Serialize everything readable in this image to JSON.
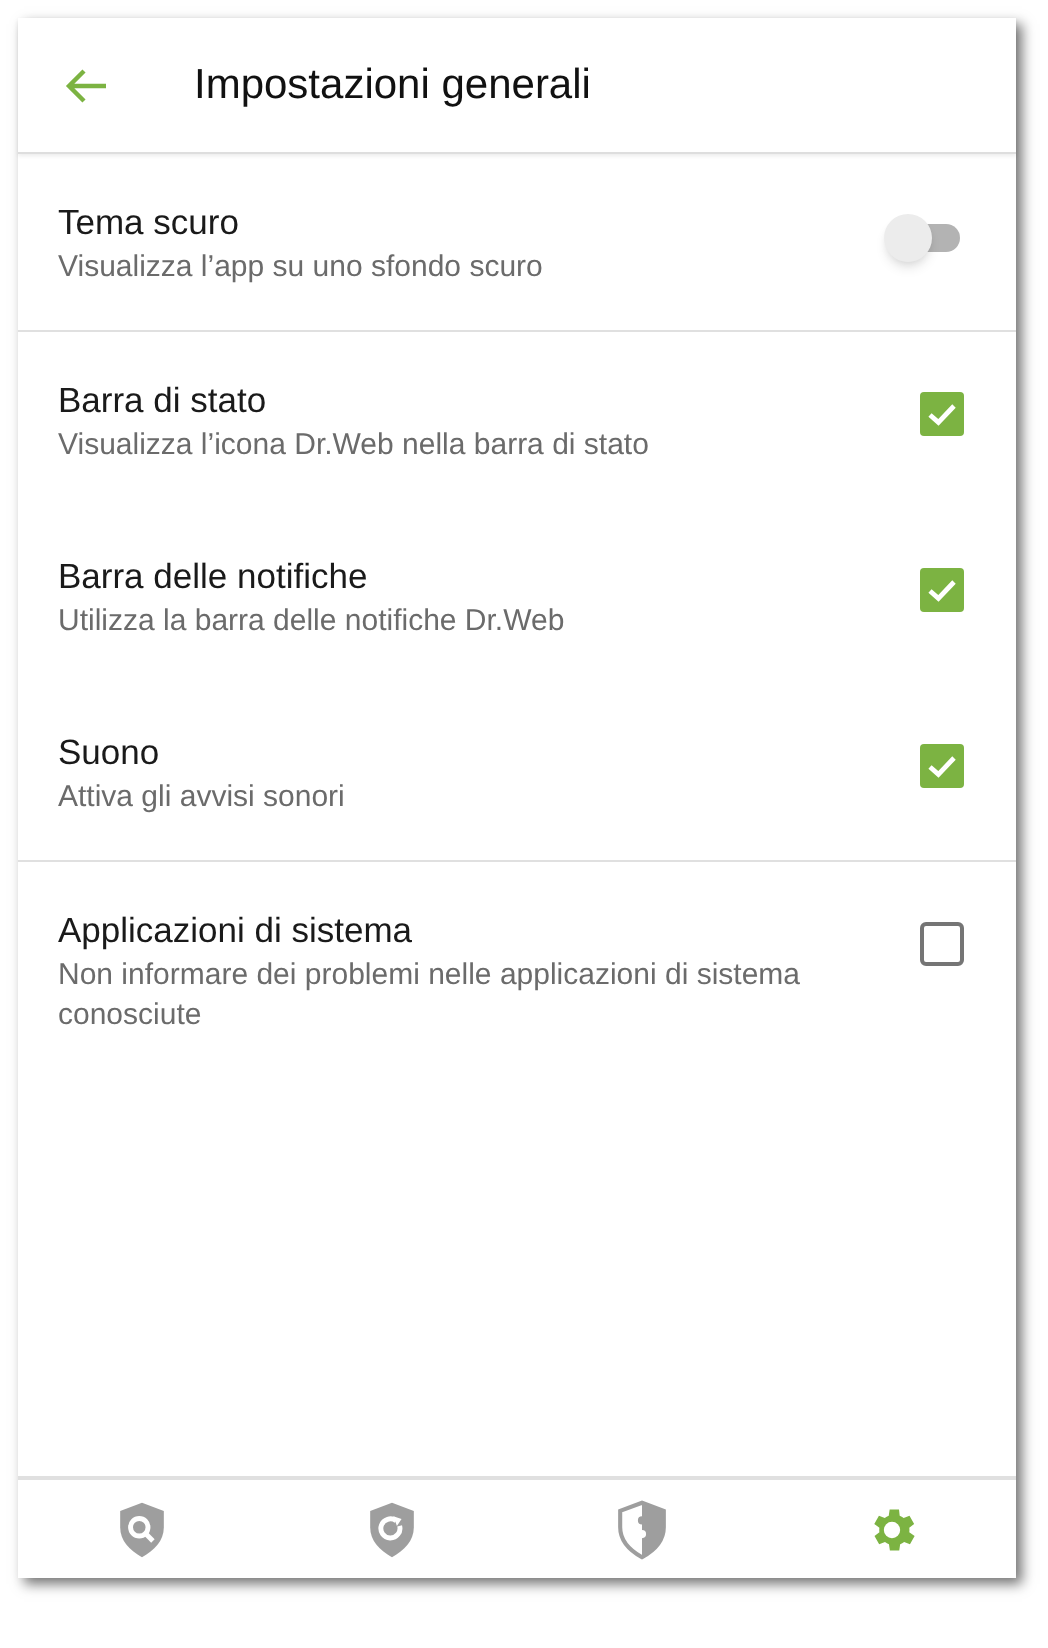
{
  "header": {
    "title": "Impostazioni generali"
  },
  "sections": [
    [
      {
        "kind": "switch",
        "title": "Tema scuro",
        "subtitle": "Visualizza l’app su uno sfondo scuro",
        "on": false
      }
    ],
    [
      {
        "kind": "checkbox",
        "title": "Barra di stato",
        "subtitle": "Visualizza l’icona Dr.Web nella barra di stato",
        "checked": true
      },
      {
        "kind": "checkbox",
        "title": "Barra delle notifiche",
        "subtitle": "Utilizza la barra delle notifiche Dr.Web",
        "checked": true
      },
      {
        "kind": "checkbox",
        "title": "Suono",
        "subtitle": "Attiva gli avvisi sonori",
        "checked": true
      }
    ],
    [
      {
        "kind": "checkbox",
        "title": "Applicazioni di sistema",
        "subtitle": "Non informare dei problemi nelle applicazioni di sistema conosciute",
        "checked": false
      }
    ]
  ],
  "bottom_nav": [
    {
      "kind": "scan",
      "selected": false
    },
    {
      "kind": "update",
      "selected": false
    },
    {
      "kind": "security",
      "selected": false
    },
    {
      "kind": "settings",
      "selected": true
    }
  ]
}
